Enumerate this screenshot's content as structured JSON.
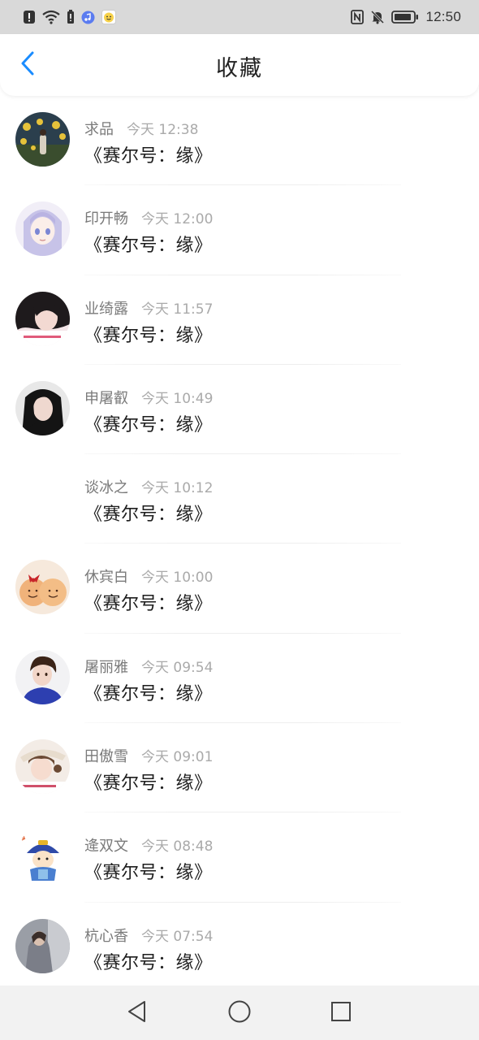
{
  "status_bar": {
    "time": "12:50",
    "left_icons": [
      "alert-icon",
      "wifi-icon",
      "sim-alert-icon",
      "music-app-icon",
      "emoji-app-icon"
    ],
    "right_icons": [
      "nfc-icon",
      "mute-bell-icon",
      "battery-icon"
    ]
  },
  "header": {
    "title": "收藏",
    "back_icon": "chevron-left-icon",
    "accent_color": "#1a8cff"
  },
  "items": [
    {
      "name": "求品",
      "time": "今天 12:38",
      "title": "《赛尔号：缘》"
    },
    {
      "name": "印开畅",
      "time": "今天 12:00",
      "title": "《赛尔号：缘》"
    },
    {
      "name": "业绮露",
      "time": "今天 11:57",
      "title": "《赛尔号：缘》"
    },
    {
      "name": "申屠叡",
      "time": "今天 10:49",
      "title": "《赛尔号：缘》"
    },
    {
      "name": "谈冰之",
      "time": "今天 10:12",
      "title": "《赛尔号：缘》"
    },
    {
      "name": "休宾白",
      "time": "今天 10:00",
      "title": "《赛尔号：缘》"
    },
    {
      "name": "屠丽雅",
      "time": "今天 09:54",
      "title": "《赛尔号：缘》"
    },
    {
      "name": "田傲雪",
      "time": "今天 09:01",
      "title": "《赛尔号：缘》"
    },
    {
      "name": "逄双文",
      "time": "今天 08:48",
      "title": "《赛尔号：缘》"
    },
    {
      "name": "杭心香",
      "time": "今天 07:54",
      "title": "《赛尔号：缘》"
    }
  ],
  "nav_bar": {
    "icons": [
      "back-triangle-icon",
      "home-circle-icon",
      "recents-square-icon"
    ]
  }
}
